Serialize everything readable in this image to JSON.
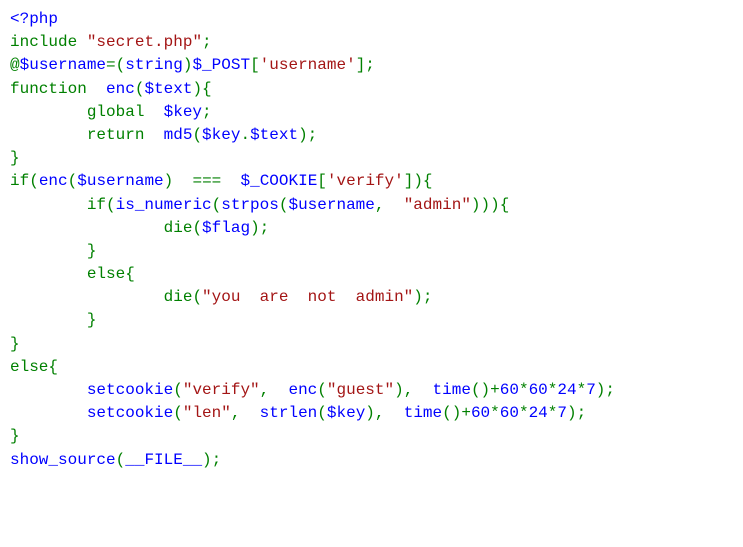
{
  "code": {
    "l1": {
      "open": "<?php"
    },
    "l2": {
      "include": "include",
      "sp": " ",
      "str": "\"secret.php\"",
      "semi": ";"
    },
    "l3": {
      "at": "@",
      "var": "$username",
      "eq": "=(",
      "cast": "string",
      "rp": ")",
      "post": "$_POST",
      "lb": "[",
      "key": "'username'",
      "rb": "];"
    },
    "l4": {
      "fn": "function",
      "sp": "  ",
      "name": "enc",
      "lp": "(",
      "arg": "$text",
      "rp": "){"
    },
    "l5": {
      "indent": "        ",
      "global": "global",
      "sp": "  ",
      "var": "$key",
      "semi": ";"
    },
    "l6": {
      "indent": "        ",
      "ret": "return",
      "sp": "  ",
      "md5": "md5",
      "lp": "(",
      "k": "$key",
      "dot": ".",
      "t": "$text",
      "rp": ");"
    },
    "l7": {
      "brace": "}"
    },
    "l8": {
      "if": "if",
      "lp": "(",
      "enc": "enc",
      "lp2": "(",
      "user": "$username",
      "rp2": ")",
      "sp": "  ",
      "eqeq": "===",
      "sp2": "  ",
      "cookie": "$_COOKIE",
      "lb": "[",
      "key": "'verify'",
      "rb": "]){"
    },
    "l9": {
      "indent": "        ",
      "if": "if",
      "lp": "(",
      "isnum": "is_numeric",
      "lp2": "(",
      "strpos": "strpos",
      "lp3": "(",
      "user": "$username",
      "comma": ",",
      "sp": "  ",
      "str": "\"admin\"",
      "rp": "))){"
    },
    "l10": {
      "indent": "                ",
      "die": "die",
      "lp": "(",
      "flag": "$flag",
      "rp": ");"
    },
    "l11": {
      "indent": "        ",
      "brace": "}"
    },
    "l12": {
      "indent": "        ",
      "else": "else",
      "lb": "{"
    },
    "l13": {
      "indent": "                ",
      "die": "die",
      "lp": "(",
      "str": "\"you  are  not  admin\"",
      "rp": ");"
    },
    "l14": {
      "indent": "        ",
      "brace": "}"
    },
    "l15": {
      "brace": "}"
    },
    "l16": {
      "else": "else",
      "lb": "{"
    },
    "l17": {
      "indent": "        ",
      "set": "setcookie",
      "lp": "(",
      "s1": "\"verify\"",
      "c1": ",",
      "sp1": "  ",
      "enc": "enc",
      "lp2": "(",
      "s2": "\"guest\"",
      "rp2": ")",
      "c2": ",",
      "sp2": "  ",
      "time": "time",
      "lp3": "()+",
      "n1": "60",
      "m1": "*",
      "n2": "60",
      "m2": "*",
      "n3": "24",
      "m3": "*",
      "n4": "7",
      "rp": ");"
    },
    "l18": {
      "indent": "        ",
      "set": "setcookie",
      "lp": "(",
      "s1": "\"len\"",
      "c1": ",",
      "sp1": "  ",
      "strlen": "strlen",
      "lp2": "(",
      "key": "$key",
      "rp2": ")",
      "c2": ",",
      "sp2": "  ",
      "time": "time",
      "lp3": "()+",
      "n1": "60",
      "m1": "*",
      "n2": "60",
      "m2": "*",
      "n3": "24",
      "m3": "*",
      "n4": "7",
      "rp": ");"
    },
    "l19": {
      "brace": "}"
    },
    "l20": {
      "show": "show_source",
      "lp": "(",
      "file": "__FILE__",
      "rp": ");"
    }
  }
}
